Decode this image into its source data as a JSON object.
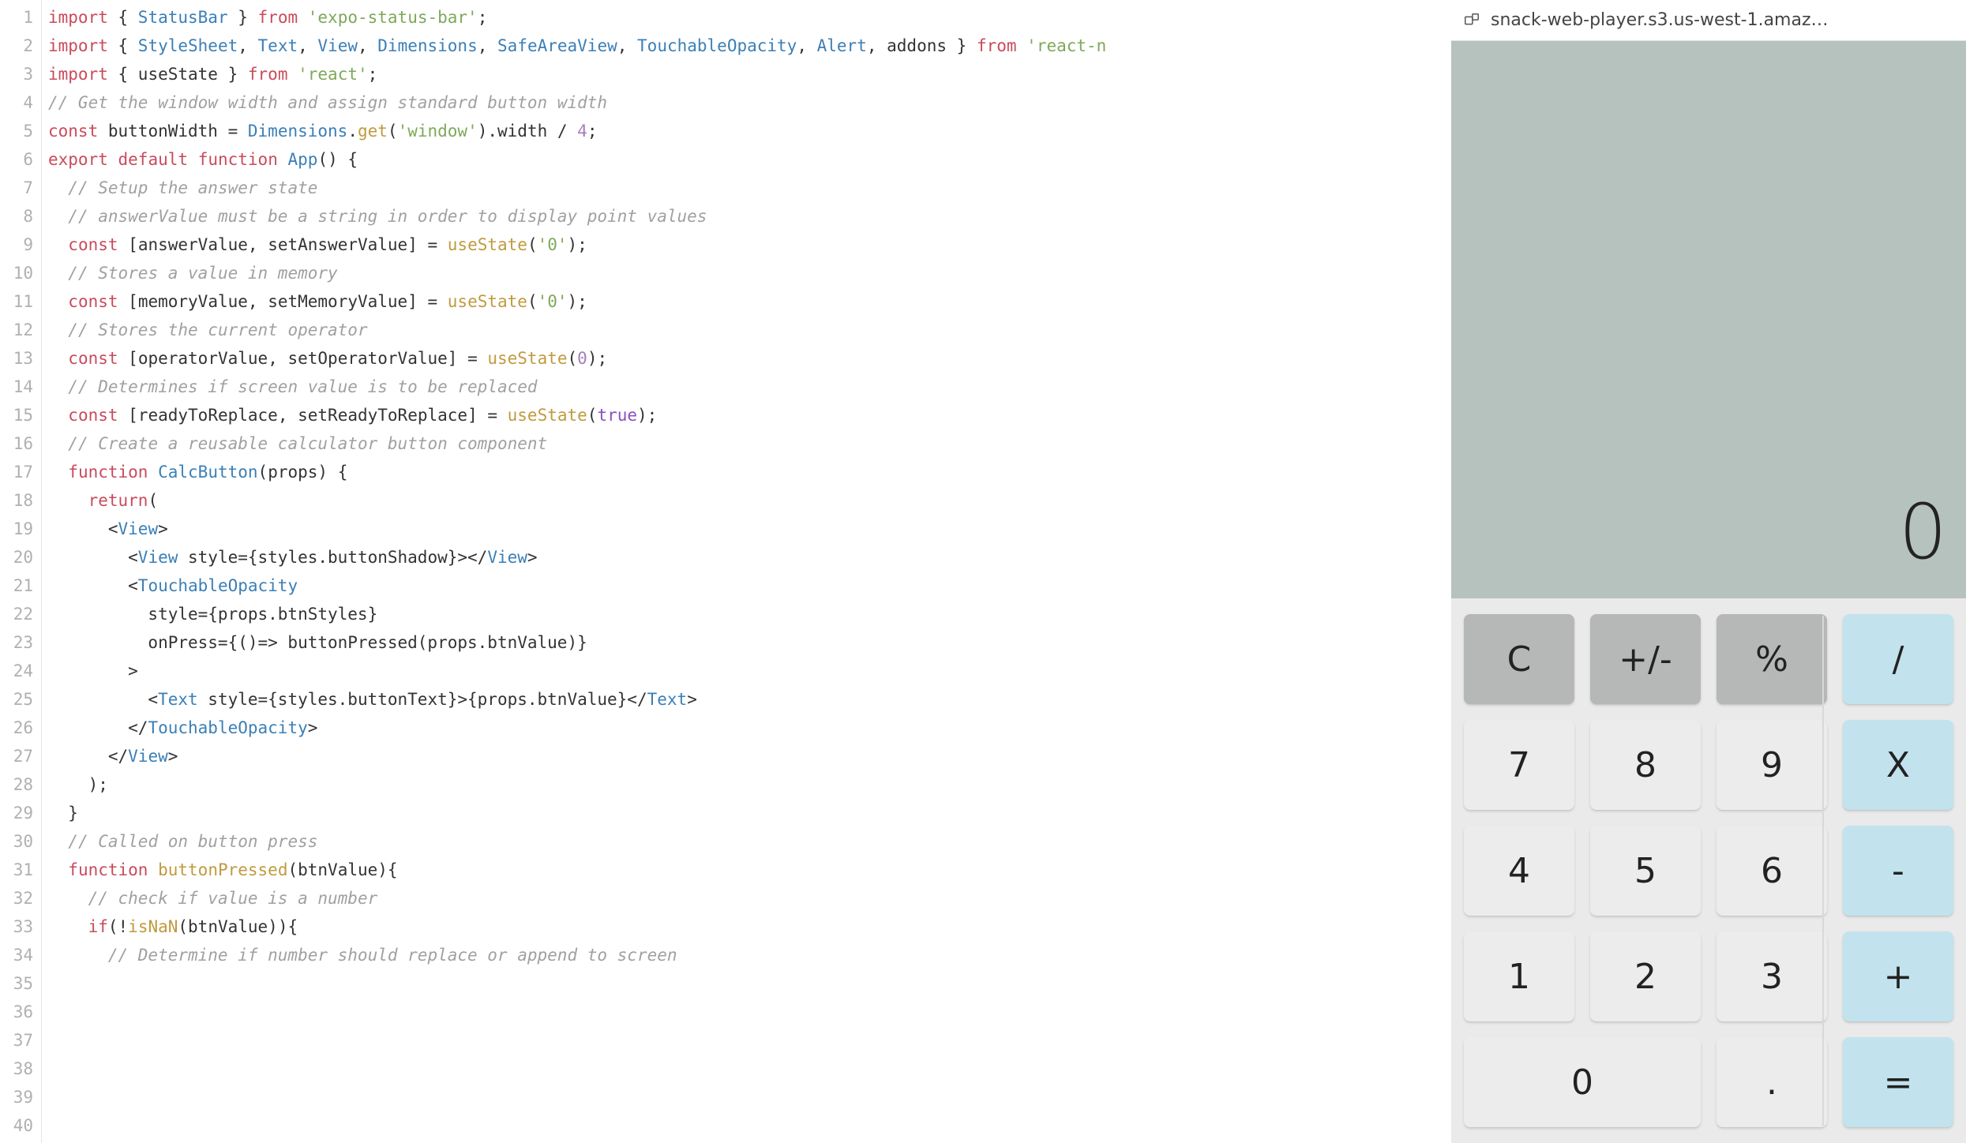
{
  "editor": {
    "lines": {
      "l1": {
        "t": [
          [
            "kw",
            "import"
          ],
          [
            "op",
            " { "
          ],
          [
            "ty",
            "StatusBar"
          ],
          [
            "op",
            " } "
          ],
          [
            "kw",
            "from"
          ],
          [
            "op",
            " "
          ],
          [
            "str",
            "'expo-status-bar'"
          ],
          [
            "op",
            ";"
          ]
        ]
      },
      "l2": {
        "t": [
          [
            "kw",
            "import"
          ],
          [
            "op",
            " { "
          ],
          [
            "ty",
            "StyleSheet"
          ],
          [
            "op",
            ", "
          ],
          [
            "ty",
            "Text"
          ],
          [
            "op",
            ", "
          ],
          [
            "ty",
            "View"
          ],
          [
            "op",
            ", "
          ],
          [
            "ty",
            "Dimensions"
          ],
          [
            "op",
            ", "
          ],
          [
            "ty",
            "SafeAreaView"
          ],
          [
            "op",
            ", "
          ],
          [
            "ty",
            "TouchableOpacity"
          ],
          [
            "op",
            ", "
          ],
          [
            "ty",
            "Alert"
          ],
          [
            "op",
            ", "
          ],
          [
            "id",
            "addons"
          ],
          [
            "op",
            " } "
          ],
          [
            "kw",
            "from"
          ],
          [
            "op",
            " "
          ],
          [
            "str",
            "'react-n"
          ]
        ]
      },
      "l3": {
        "t": [
          [
            "kw",
            "import"
          ],
          [
            "op",
            " { "
          ],
          [
            "id",
            "useState"
          ],
          [
            "op",
            " } "
          ],
          [
            "kw",
            "from"
          ],
          [
            "op",
            " "
          ],
          [
            "str",
            "'react'"
          ],
          [
            "op",
            ";"
          ]
        ]
      },
      "l4": {
        "t": [
          [
            "op",
            ""
          ]
        ]
      },
      "l5": {
        "t": [
          [
            "cm",
            "// Get the window width and assign standard button width"
          ]
        ]
      },
      "l6": {
        "t": [
          [
            "kw",
            "const"
          ],
          [
            "op",
            " "
          ],
          [
            "id",
            "buttonWidth"
          ],
          [
            "op",
            " = "
          ],
          [
            "ty",
            "Dimensions"
          ],
          [
            "op",
            "."
          ],
          [
            "fn",
            "get"
          ],
          [
            "op",
            "("
          ],
          [
            "str",
            "'window'"
          ],
          [
            "op",
            ").width / "
          ],
          [
            "num",
            "4"
          ],
          [
            "op",
            ";"
          ]
        ]
      },
      "l7": {
        "t": [
          [
            "op",
            ""
          ]
        ]
      },
      "l8": {
        "t": [
          [
            "kw",
            "export"
          ],
          [
            "op",
            " "
          ],
          [
            "kw",
            "default"
          ],
          [
            "op",
            " "
          ],
          [
            "kw",
            "function"
          ],
          [
            "op",
            " "
          ],
          [
            "ty",
            "App"
          ],
          [
            "op",
            "() {"
          ]
        ]
      },
      "l9": {
        "t": [
          [
            "op",
            "  "
          ],
          [
            "cm",
            "// Setup the answer state"
          ]
        ]
      },
      "l10": {
        "t": [
          [
            "op",
            "  "
          ],
          [
            "cm",
            "// answerValue must be a string in order to display point values"
          ]
        ]
      },
      "l11": {
        "t": [
          [
            "op",
            "  "
          ],
          [
            "kw",
            "const"
          ],
          [
            "op",
            " ["
          ],
          [
            "id",
            "answerValue"
          ],
          [
            "op",
            ", "
          ],
          [
            "id",
            "setAnswerValue"
          ],
          [
            "op",
            "] = "
          ],
          [
            "fn",
            "useState"
          ],
          [
            "op",
            "("
          ],
          [
            "str",
            "'0'"
          ],
          [
            "op",
            ");"
          ]
        ]
      },
      "l12": {
        "t": [
          [
            "op",
            ""
          ]
        ]
      },
      "l13": {
        "t": [
          [
            "op",
            "  "
          ],
          [
            "cm",
            "// Stores a value in memory"
          ]
        ]
      },
      "l14": {
        "t": [
          [
            "op",
            "  "
          ],
          [
            "kw",
            "const"
          ],
          [
            "op",
            " ["
          ],
          [
            "id",
            "memoryValue"
          ],
          [
            "op",
            ", "
          ],
          [
            "id",
            "setMemoryValue"
          ],
          [
            "op",
            "] = "
          ],
          [
            "fn",
            "useState"
          ],
          [
            "op",
            "("
          ],
          [
            "str",
            "'0'"
          ],
          [
            "op",
            ");"
          ]
        ]
      },
      "l15": {
        "t": [
          [
            "op",
            "  "
          ],
          [
            "cm",
            "// Stores the current operator"
          ]
        ]
      },
      "l16": {
        "t": [
          [
            "op",
            "  "
          ],
          [
            "kw",
            "const"
          ],
          [
            "op",
            " ["
          ],
          [
            "id",
            "operatorValue"
          ],
          [
            "op",
            ", "
          ],
          [
            "id",
            "setOperatorValue"
          ],
          [
            "op",
            "] = "
          ],
          [
            "fn",
            "useState"
          ],
          [
            "op",
            "("
          ],
          [
            "num",
            "0"
          ],
          [
            "op",
            ");"
          ]
        ]
      },
      "l17": {
        "t": [
          [
            "op",
            "  "
          ],
          [
            "cm",
            "// Determines if screen value is to be replaced"
          ]
        ]
      },
      "l18": {
        "t": [
          [
            "op",
            "  "
          ],
          [
            "kw",
            "const"
          ],
          [
            "op",
            " ["
          ],
          [
            "id",
            "readyToReplace"
          ],
          [
            "op",
            ", "
          ],
          [
            "id",
            "setReadyToReplace"
          ],
          [
            "op",
            "] = "
          ],
          [
            "fn",
            "useState"
          ],
          [
            "op",
            "("
          ],
          [
            "bool",
            "true"
          ],
          [
            "op",
            ");"
          ]
        ]
      },
      "l19": {
        "t": [
          [
            "op",
            ""
          ]
        ]
      },
      "l20": {
        "t": [
          [
            "op",
            "  "
          ],
          [
            "cm",
            "// Create a reusable calculator button component"
          ]
        ]
      },
      "l21": {
        "t": [
          [
            "op",
            "  "
          ],
          [
            "kw",
            "function"
          ],
          [
            "op",
            " "
          ],
          [
            "ty",
            "CalcButton"
          ],
          [
            "op",
            "(props) {"
          ]
        ]
      },
      "l22": {
        "t": [
          [
            "op",
            "    "
          ],
          [
            "kw",
            "return"
          ],
          [
            "op",
            "("
          ]
        ]
      },
      "l23": {
        "t": [
          [
            "op",
            "      <"
          ],
          [
            "ty",
            "View"
          ],
          [
            "op",
            ">"
          ]
        ]
      },
      "l24": {
        "t": [
          [
            "op",
            "        <"
          ],
          [
            "ty",
            "View"
          ],
          [
            "op",
            " style={styles.buttonShadow}></"
          ],
          [
            "ty",
            "View"
          ],
          [
            "op",
            ">"
          ]
        ]
      },
      "l25": {
        "t": [
          [
            "op",
            "        <"
          ],
          [
            "ty",
            "TouchableOpacity"
          ]
        ]
      },
      "l26": {
        "t": [
          [
            "op",
            "          style={props.btnStyles}"
          ]
        ]
      },
      "l27": {
        "t": [
          [
            "op",
            "          onPress={()=> buttonPressed(props.btnValue)}"
          ]
        ]
      },
      "l28": {
        "t": [
          [
            "op",
            "        >"
          ]
        ]
      },
      "l29": {
        "t": [
          [
            "op",
            "          <"
          ],
          [
            "ty",
            "Text"
          ],
          [
            "op",
            " style={styles.buttonText}>{props.btnValue}</"
          ],
          [
            "ty",
            "Text"
          ],
          [
            "op",
            ">"
          ]
        ]
      },
      "l30": {
        "t": [
          [
            "op",
            "        </"
          ],
          [
            "ty",
            "TouchableOpacity"
          ],
          [
            "op",
            ">"
          ]
        ]
      },
      "l31": {
        "t": [
          [
            "op",
            "      </"
          ],
          [
            "ty",
            "View"
          ],
          [
            "op",
            ">"
          ]
        ]
      },
      "l32": {
        "t": [
          [
            "op",
            ""
          ]
        ]
      },
      "l33": {
        "t": [
          [
            "op",
            "    );"
          ]
        ]
      },
      "l34": {
        "t": [
          [
            "op",
            "  }"
          ]
        ]
      },
      "l35": {
        "t": [
          [
            "op",
            ""
          ]
        ]
      },
      "l36": {
        "t": [
          [
            "op",
            "  "
          ],
          [
            "cm",
            "// Called on button press"
          ]
        ]
      },
      "l37": {
        "t": [
          [
            "op",
            "  "
          ],
          [
            "kw",
            "function"
          ],
          [
            "op",
            " "
          ],
          [
            "fn",
            "buttonPressed"
          ],
          [
            "op",
            "(btnValue){"
          ]
        ]
      },
      "l38": {
        "t": [
          [
            "op",
            "    "
          ],
          [
            "cm",
            "// check if value is a number"
          ]
        ]
      },
      "l39": {
        "t": [
          [
            "op",
            "    "
          ],
          [
            "kw",
            "if"
          ],
          [
            "op",
            "(!"
          ],
          [
            "fn",
            "isNaN"
          ],
          [
            "op",
            "(btnValue)){"
          ]
        ]
      },
      "l40": {
        "t": [
          [
            "op",
            "      "
          ],
          [
            "cm",
            "// Determine if number should replace or append to screen"
          ]
        ]
      }
    },
    "lineCount": 40
  },
  "preview": {
    "header": {
      "title": "snack-web-player.s3.us-west-1.amaz…"
    },
    "display": "0",
    "buttons": {
      "c": "C",
      "pm": "+/-",
      "pct": "%",
      "div": "/",
      "n7": "7",
      "n8": "8",
      "n9": "9",
      "mul": "X",
      "n4": "4",
      "n5": "5",
      "n6": "6",
      "sub": "-",
      "n1": "1",
      "n2": "2",
      "n3": "3",
      "add": "+",
      "n0": "0",
      "dot": ".",
      "eq": "="
    }
  }
}
